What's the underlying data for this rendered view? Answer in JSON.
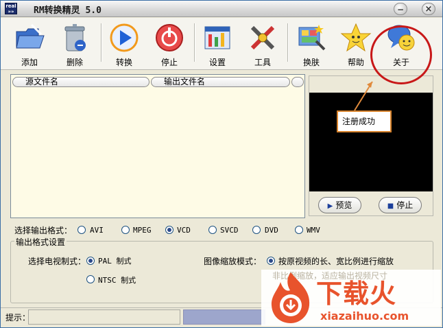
{
  "window": {
    "title": "RM转换精灵 5.0",
    "icon_text": "real"
  },
  "toolbar": {
    "add": "添加",
    "delete": "删除",
    "convert": "转换",
    "stop": "停止",
    "settings": "设置",
    "tools": "工具",
    "skin": "换肤",
    "help": "帮助",
    "about": "关于"
  },
  "filelist": {
    "col_source": "源文件名",
    "col_output": "输出文件名"
  },
  "preview": {
    "preview_label": "预览",
    "stop_label": "停止"
  },
  "callout": {
    "text": "注册成功"
  },
  "output_format": {
    "label": "选择输出格式：",
    "options": [
      "AVI",
      "MPEG",
      "VCD",
      "SVCD",
      "DVD",
      "WMV"
    ],
    "selected": "VCD"
  },
  "settings_group": {
    "title": "输出格式设置",
    "tv_label": "选择电视制式：",
    "pal": "PAL  制式",
    "ntsc": "NTSC 制式",
    "scale_label": "图像缩放模式：",
    "scale_keep": "按原视频的长、宽比例进行缩放",
    "scale_stretch": "非比例缩放，适应输出视频尺寸"
  },
  "status": {
    "label": "提示："
  },
  "watermark": {
    "brand": "下载火",
    "url": "xiazaihuo.com"
  },
  "colors": {
    "accent": "#c81818",
    "callout_border": "#d7822b",
    "list_bg": "#fefbe6"
  }
}
